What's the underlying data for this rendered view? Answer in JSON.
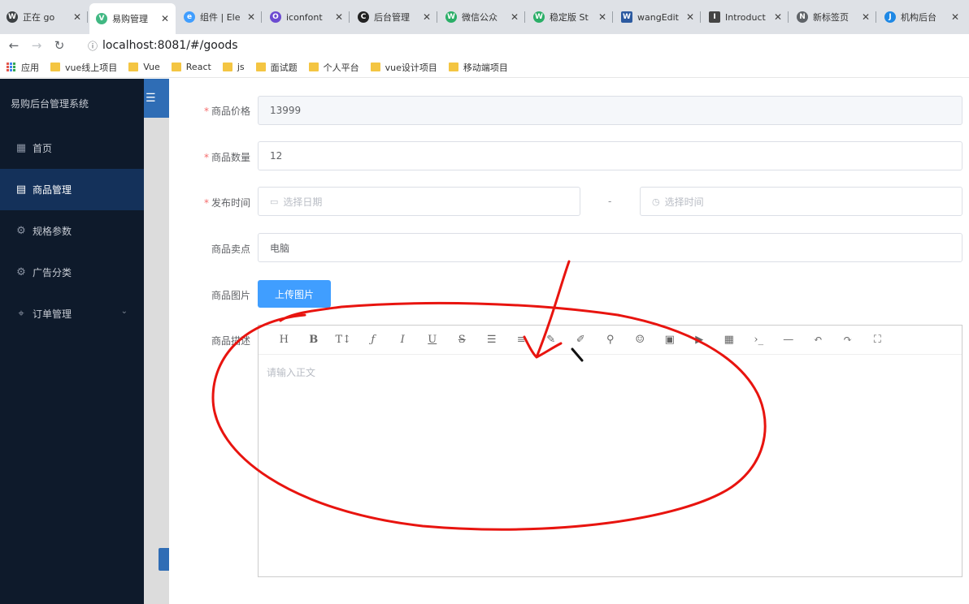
{
  "browser": {
    "tabs": [
      {
        "label": "正在    go",
        "color": "#3c4043",
        "glyph": "W"
      },
      {
        "label": "易购管理",
        "color": "#41b883",
        "glyph": "V"
      },
      {
        "label": "组件 | Ele",
        "color": "#409eff",
        "glyph": "e"
      },
      {
        "label": "iconfont",
        "color": "#6c4bd1",
        "glyph": "O"
      },
      {
        "label": "后台管理",
        "color": "#222222",
        "glyph": "C"
      },
      {
        "label": "微信公众",
        "color": "#2aae67",
        "glyph": "W"
      },
      {
        "label": "稳定版 St",
        "color": "#2aae67",
        "glyph": "W"
      },
      {
        "label": "wangEdit",
        "color": "#2c5aa0",
        "glyph": "W"
      },
      {
        "label": "Introduct",
        "color": "#444444",
        "glyph": "I"
      },
      {
        "label": "新标签页",
        "color": "#5f6368",
        "glyph": "N"
      },
      {
        "label": "机构后台",
        "color": "#1e88e5",
        "glyph": "J"
      }
    ],
    "url": "localhost:8081/#/goods",
    "bookmarks": [
      "应用",
      "vue线上项目",
      "Vue",
      "React",
      "js",
      "面试题",
      "个人平台",
      "vue设计项目",
      "移动端项目"
    ]
  },
  "sidebar": {
    "title": "易购后台管理系统",
    "items": [
      {
        "label": "首页",
        "icon": "grid-icon"
      },
      {
        "label": "商品管理",
        "icon": "document-icon"
      },
      {
        "label": "规格参数",
        "icon": "settings-icon"
      },
      {
        "label": "广告分类",
        "icon": "settings-icon"
      },
      {
        "label": "订单管理",
        "icon": "location-icon"
      }
    ],
    "active_index": 1
  },
  "form": {
    "price": {
      "label": "商品价格",
      "value": "13999"
    },
    "quantity": {
      "label": "商品数量",
      "value": "12"
    },
    "publish": {
      "label": "发布时间",
      "date_placeholder": "选择日期",
      "time_placeholder": "选择时间",
      "separator": "-"
    },
    "selling_point": {
      "label": "商品卖点",
      "value": "电脑"
    },
    "image": {
      "label": "商品图片",
      "upload_label": "上传图片"
    },
    "description": {
      "label": "商品描述",
      "placeholder": "请输入正文"
    }
  },
  "colors": {
    "sidebar_bg": "#0e1a2b",
    "sidebar_active": "#14315a",
    "primary": "#409eff",
    "required": "#f56c6c",
    "annotation": "#e8140f"
  }
}
